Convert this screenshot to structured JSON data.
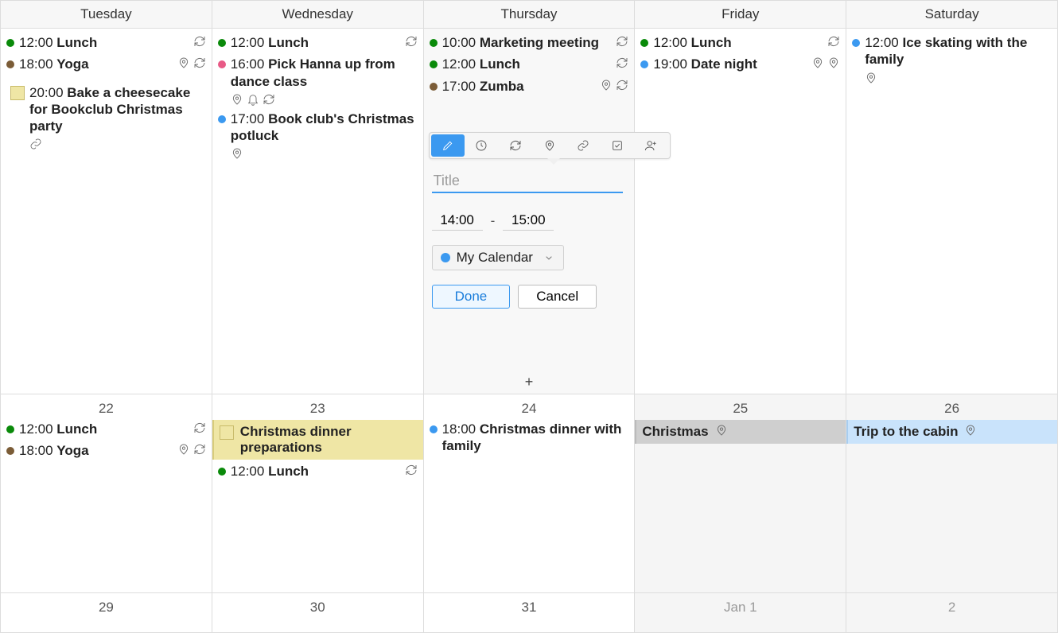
{
  "days": [
    "Tuesday",
    "Wednesday",
    "Thursday",
    "Friday",
    "Saturday"
  ],
  "colors": {
    "green": "#0a8a0a",
    "brown": "#7b5c37",
    "pink": "#e85a86",
    "blue": "#3b99f0",
    "taskbg": "#efe6a5"
  },
  "weeks": [
    {
      "cells": [
        {
          "events": [
            {
              "dot": "green",
              "time": "12:00",
              "title": "Lunch",
              "icons": [
                "recur"
              ]
            },
            {
              "dot": "brown",
              "time": "18:00",
              "title": "Yoga",
              "icons": [
                "location",
                "recur"
              ]
            },
            {
              "task": true,
              "time": "20:00",
              "title": "Bake a cheesecake for Bookclub Christmas party",
              "icons": [
                "link"
              ]
            }
          ]
        },
        {
          "events": [
            {
              "dot": "green",
              "time": "12:00",
              "title": "Lunch",
              "icons": [
                "recur"
              ]
            },
            {
              "dot": "pink",
              "time": "16:00",
              "title": "Pick Hanna up from dance class",
              "icons": [
                "location",
                "bell",
                "recur"
              ]
            },
            {
              "dot": "blue",
              "time": "17:00",
              "title": "Book club's Christmas potluck",
              "icons": [
                "location"
              ]
            }
          ]
        },
        {
          "active": true,
          "events": [
            {
              "dot": "green",
              "time": "10:00",
              "title": "Marketing meeting",
              "icons": [
                "recur"
              ]
            },
            {
              "dot": "green",
              "time": "12:00",
              "title": "Lunch",
              "icons": [
                "recur"
              ]
            },
            {
              "dot": "brown",
              "time": "17:00",
              "title": "Zumba",
              "icons": [
                "location",
                "recur"
              ]
            }
          ]
        },
        {
          "events": [
            {
              "dot": "green",
              "time": "12:00",
              "title": "Lunch",
              "icons": [
                "recur"
              ]
            },
            {
              "dot": "blue",
              "time": "19:00",
              "title": "Date night",
              "icons": [
                "location",
                "location"
              ]
            }
          ]
        },
        {
          "events": [
            {
              "dot": "blue",
              "time": "12:00",
              "title": "Ice skating with the family",
              "icons": [
                "location"
              ]
            }
          ]
        }
      ]
    },
    {
      "short": true,
      "cells": [
        {
          "date": "22",
          "events": [
            {
              "dot": "green",
              "time": "12:00",
              "title": "Lunch",
              "icons": [
                "recur"
              ]
            },
            {
              "dot": "brown",
              "time": "18:00",
              "title": "Yoga",
              "icons": [
                "location",
                "recur"
              ]
            }
          ]
        },
        {
          "date": "23",
          "banner": {
            "kind": "yellow",
            "swatch": true,
            "title": "Christmas dinner preparations"
          },
          "events": [
            {
              "dot": "green",
              "time": "12:00",
              "title": "Lunch",
              "icons": [
                "recur"
              ]
            }
          ]
        },
        {
          "date": "24",
          "events": [
            {
              "dot": "blue",
              "time": "18:00",
              "title": "Christmas dinner with family"
            }
          ]
        },
        {
          "date": "25",
          "outside": true,
          "banner": {
            "kind": "gray",
            "title": "Christmas",
            "icons": [
              "location"
            ]
          }
        },
        {
          "date": "26",
          "outside": true,
          "banner": {
            "kind": "blue",
            "title": "Trip to the cabin",
            "icons": [
              "location"
            ]
          }
        }
      ]
    },
    {
      "tiny": true,
      "cells": [
        {
          "date": "29"
        },
        {
          "date": "30"
        },
        {
          "date": "31"
        },
        {
          "date": "Jan  1",
          "outside": true
        },
        {
          "date": "2",
          "outside": true
        }
      ]
    }
  ],
  "popup": {
    "title_placeholder": "Title",
    "time_from": "14:00",
    "time_to": "15:00",
    "dash": "-",
    "calendar_label": "My Calendar",
    "done": "Done",
    "cancel": "Cancel"
  }
}
